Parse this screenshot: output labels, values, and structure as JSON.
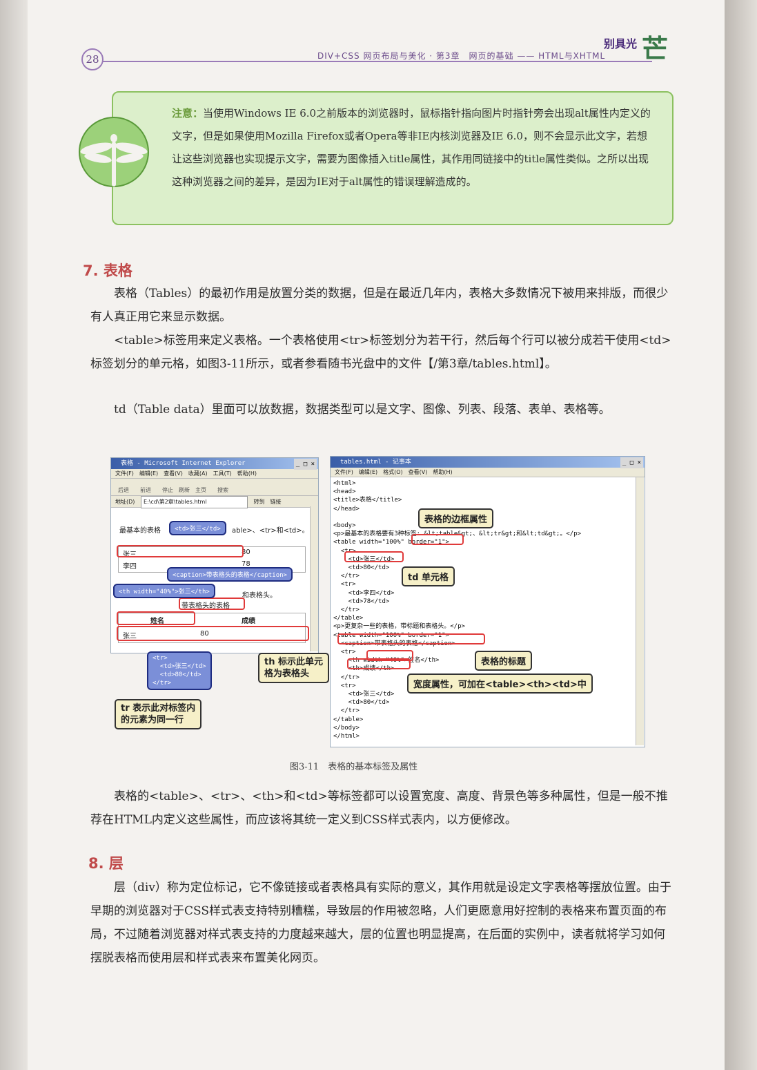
{
  "header": {
    "page_number": "28",
    "running_title": "DIV+CSS 网页布局与美化 · 第3章　网页的基础 —— HTML与XHTML",
    "brand_small": "别具光",
    "brand_large": "芒"
  },
  "note": {
    "label": "注意：",
    "text": "当使用Windows IE 6.0之前版本的浏览器时，鼠标指针指向图片时指针旁会出现alt属性内定义的文字，但是如果使用Mozilla Firefox或者Opera等非IE内核浏览器及IE 6.0，则不会显示此文字，若想让这些浏览器也实现提示文字，需要为图像插入title属性，其作用同链接中的title属性类似。之所以出现这种浏览器之间的差异，是因为IE对于alt属性的错误理解造成的。"
  },
  "section7": {
    "heading": "7. 表格",
    "p1": "表格（Tables）的最初作用是放置分类的数据，但是在最近几年内，表格大多数情况下被用来排版，而很少有人真正用它来显示数据。",
    "p2": "<table>标签用来定义表格。一个表格使用<tr>标签划分为若干行，然后每个行可以被分成若干使用<td>标签划分的单元格，如图3-11所示，或者参看随书光盘中的文件【/第3章/tables.html】。",
    "p3": "td（Table data）里面可以放数据，数据类型可以是文字、图像、列表、段落、表单、表格等。"
  },
  "figure": {
    "ie": {
      "title": "表格 - Microsoft Internet Explorer",
      "menu": "文件(F)　编辑(E)　查看(V)　收藏(A)　工具(T)　帮助(H)",
      "toolbar": "后退　　前进　　停止　刷新　主页　　搜索",
      "address_label": "地址(D)",
      "address_value": "E:\\cd\\第2章\\tables.html",
      "go": "转到　链接",
      "line1": "最基本的表格",
      "line1b": "able>、<tr>和<td>。",
      "r1c1": "张三",
      "r1c2": "80",
      "r2c1": "李四",
      "r2c2": "78",
      "caption_text": "带表格头的表格",
      "th1": "姓名",
      "th2": "成绩",
      "r3c1": "张三",
      "r3c2": "80",
      "partial_text": "和表格头。"
    },
    "notepad": {
      "title": "tables.html - 记事本",
      "menu": "文件(F)　编辑(E)　格式(O)　查看(V)　帮助(H)",
      "code_lines": [
        "<html>",
        "<head>",
        "<title>表格</title>",
        "</head>",
        "",
        "<body>",
        "<p>最基本的表格要有3种标签: &lt;table&gt;、&lt;tr&gt;和&lt;td&gt;。</p>",
        "<table width=\"100%\" border=\"1\">",
        "  <tr>",
        "    <td>张三</td>",
        "    <td>80</td>",
        "  </tr>",
        "  <tr>",
        "    <td>李四</td>",
        "    <td>78</td>",
        "  </tr>",
        "</table>",
        "<p>更复杂一些的表格，带标题和表格头。</p>",
        "<table width=\"100%\" border=\"1\">",
        "  <caption>带表格头的表格</caption>",
        "  <tr>",
        "    <th width=\"40%\">姓名</th>",
        "    <th>成绩</th>",
        "  </tr>",
        "  <tr>",
        "    <td>张三</td>",
        "    <td>80</td>",
        "  </tr>",
        "</table>",
        "</body>",
        "</html>"
      ]
    },
    "bubbles": {
      "td": "<td>张三</td>",
      "caption": "<caption>带表格头的表格</caption>",
      "th": "<th width=\"40%\">张三</th>",
      "tr": "<tr>\n  <td>张三</td>\n  <td>80</td>\n</tr>"
    },
    "callouts": {
      "border": "表格的边框属性",
      "td": "td 单元格",
      "th": "th 标示此单元\n格为表格头",
      "tr": "tr 表示此对标签内\n的元素为同一行",
      "caption": "表格的标题",
      "width": "宽度属性，可加在<table><th><td>中"
    },
    "caption": "图3-11　表格的基本标签及属性"
  },
  "after_figure": {
    "p": "表格的<table>、<tr>、<th>和<td>等标签都可以设置宽度、高度、背景色等多种属性，但是一般不推荐在HTML内定义这些属性，而应该将其统一定义到CSS样式表内，以方便修改。"
  },
  "section8": {
    "heading": "8. 层",
    "p1": "层（div）称为定位标记，它不像链接或者表格具有实际的意义，其作用就是设定文字表格等摆放位置。由于早期的浏览器对于CSS样式表支持特别糟糕，导致层的作用被忽略，人们更愿意用好控制的表格来布置页面的布局，不过随着浏览器对样式表支持的力度越来越大，层的位置也明显提高，在后面的实例中，读者就将学习如何摆脱表格而使用层和样式表来布置美化网页。"
  },
  "colors": {
    "heading_red": "#c04a4a",
    "note_green": "#dcefcb",
    "header_purple": "#9a7bb8",
    "bubble_blue": "#7b8fd8",
    "callout_yellow": "#f6f0c8"
  }
}
